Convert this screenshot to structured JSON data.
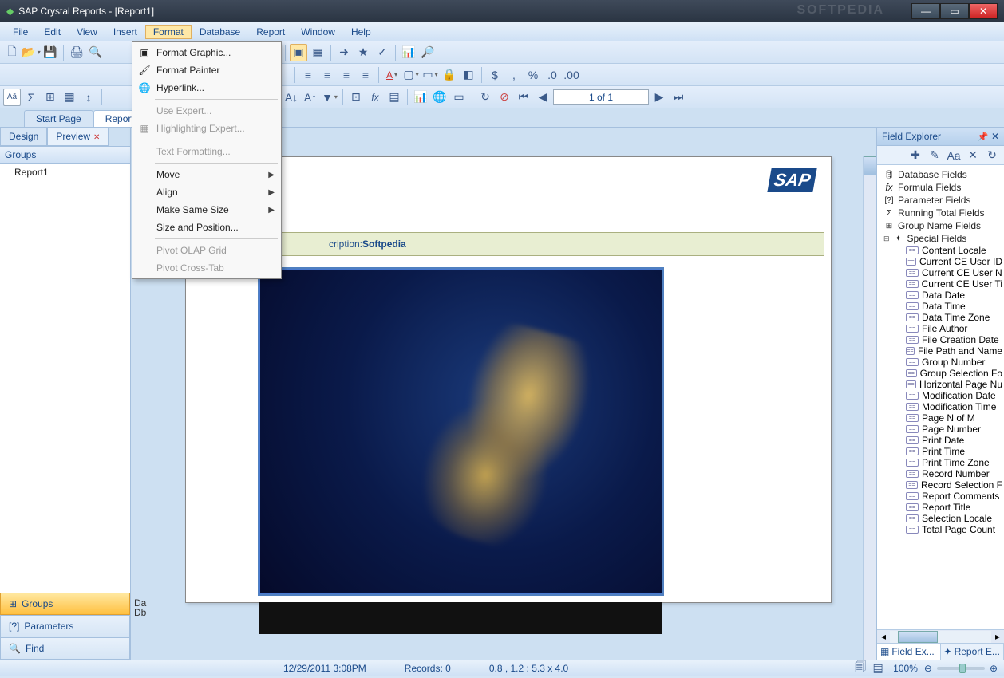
{
  "window": {
    "app_title": "SAP Crystal Reports - [Report1]",
    "watermark": "SOFTPEDIA"
  },
  "menubar": {
    "file": "File",
    "edit": "Edit",
    "view": "View",
    "insert": "Insert",
    "format": "Format",
    "database": "Database",
    "report": "Report",
    "window": "Window",
    "help": "Help"
  },
  "format_menu": {
    "format_graphic": "Format Graphic...",
    "format_painter": "Format Painter",
    "hyperlink": "Hyperlink...",
    "use_expert": "Use Expert...",
    "highlighting_expert": "Highlighting Expert...",
    "text_formatting": "Text Formatting...",
    "move": "Move",
    "align": "Align",
    "make_same_size": "Make Same Size",
    "size_and_position": "Size and Position...",
    "pivot_olap_grid": "Pivot OLAP Grid",
    "pivot_crosstab": "Pivot Cross-Tab"
  },
  "tabs": {
    "start_page": "Start Page",
    "report1": "Report1"
  },
  "design_preview": {
    "design": "Design",
    "preview": "Preview"
  },
  "left": {
    "groups_header": "Groups",
    "tree_root": "Report1",
    "groups_btn": "Groups",
    "parameters_btn": "Parameters",
    "find_btn": "Find",
    "section_da": "Da",
    "section_db": "Db"
  },
  "nav": {
    "page_indicator": "1 of 1"
  },
  "canvas": {
    "sap_logo": "SAP",
    "description_label": "cription:",
    "description_value": "Softpedia"
  },
  "field_explorer": {
    "title": "Field Explorer",
    "top_nodes": {
      "database_fields": "Database Fields",
      "formula_fields": "Formula Fields",
      "parameter_fields": "Parameter Fields",
      "running_total_fields": "Running Total Fields",
      "group_name_fields": "Group Name Fields",
      "special_fields": "Special Fields"
    },
    "special_fields": [
      "Content Locale",
      "Current CE User ID",
      "Current CE User N",
      "Current CE User Ti",
      "Data Date",
      "Data Time",
      "Data Time Zone",
      "File Author",
      "File Creation Date",
      "File Path and Name",
      "Group Number",
      "Group Selection Fo",
      "Horizontal Page Nu",
      "Modification Date",
      "Modification Time",
      "Page N of M",
      "Page Number",
      "Print Date",
      "Print Time",
      "Print Time Zone",
      "Record Number",
      "Record Selection F",
      "Report Comments",
      "Report Title",
      "Selection Locale",
      "Total Page Count"
    ],
    "tabs": {
      "field_ex": "Field Ex...",
      "report_e": "Report E..."
    }
  },
  "status": {
    "datetime": "12/29/2011  3:08PM",
    "records": "Records:  0",
    "coords": "0.8 , 1.2 : 5.3 x 4.0",
    "zoom": "100%"
  }
}
